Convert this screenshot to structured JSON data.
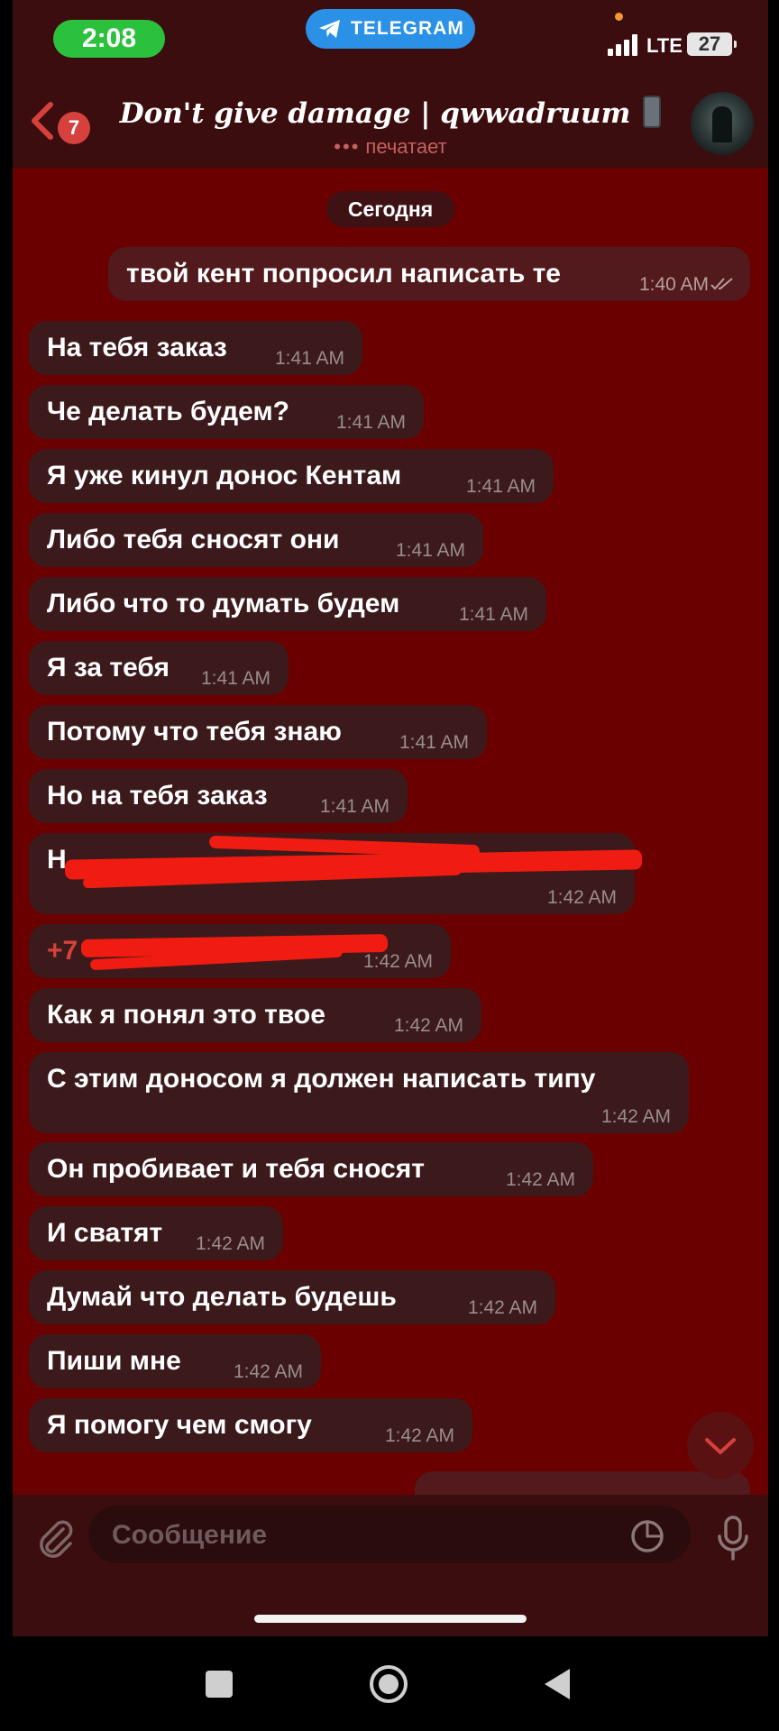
{
  "status_bar": {
    "time": "2:08",
    "app_pill": "TELEGRAM",
    "network": "LTE",
    "battery": "27"
  },
  "header": {
    "back_badge": "7",
    "title": "Don't give damage | qwwadruum",
    "status": "печатает",
    "typing_dots": "•••"
  },
  "chat": {
    "date": "Сегодня",
    "messages": [
      {
        "dir": "out",
        "text": "твой кент попросил написать те",
        "time": "1:40 AM"
      },
      {
        "dir": "in",
        "text": "На тебя заказ",
        "time": "1:41 AM"
      },
      {
        "dir": "in",
        "text": "Че делать будем?",
        "time": "1:41 AM"
      },
      {
        "dir": "in",
        "text": "Я уже кинул донос Кентам",
        "time": "1:41 AM"
      },
      {
        "dir": "in",
        "text": "Либо тебя сносят они",
        "time": "1:41 AM"
      },
      {
        "dir": "in",
        "text": "Либо что то думать будем",
        "time": "1:41 AM"
      },
      {
        "dir": "in",
        "text": "Я за тебя",
        "time": "1:41 AM"
      },
      {
        "dir": "in",
        "text": "Потому что тебя знаю",
        "time": "1:41 AM"
      },
      {
        "dir": "in",
        "text": "Но на тебя заказ",
        "time": "1:41 AM"
      },
      {
        "dir": "in",
        "text": "Н",
        "time": "1:42 AM"
      },
      {
        "dir": "in",
        "text": "+7",
        "time": "1:42 AM"
      },
      {
        "dir": "in",
        "text": "Как я понял это твое",
        "time": "1:42 AM"
      },
      {
        "dir": "in",
        "text": "С этим доносом я должен написать типу",
        "time": "1:42 AM"
      },
      {
        "dir": "in",
        "text": "Он пробивает и тебя сносят",
        "time": "1:42 AM"
      },
      {
        "dir": "in",
        "text": "И сватят",
        "time": "1:42 AM"
      },
      {
        "dir": "in",
        "text": "Думай что делать будешь",
        "time": "1:42 AM"
      },
      {
        "dir": "in",
        "text": "Пиши мне",
        "time": "1:42 AM"
      },
      {
        "dir": "in",
        "text": "Я помогу чем смогу",
        "time": "1:42 AM"
      }
    ]
  },
  "input": {
    "placeholder": "Сообщение"
  },
  "icons": {
    "back": "chevron-left-icon",
    "attach": "paperclip-icon",
    "sticker": "sticker-icon",
    "mic": "microphone-icon",
    "scroll": "chevron-down-icon"
  },
  "colors": {
    "chat_bg": "#6b0000",
    "bar_bg": "#3c0d0e",
    "bubble_in": "#3c1a1b",
    "bubble_out": "#521a1c",
    "accent_red": "#d6413d",
    "telegram_blue": "#2a91e6",
    "time_green": "#2bc13d"
  }
}
